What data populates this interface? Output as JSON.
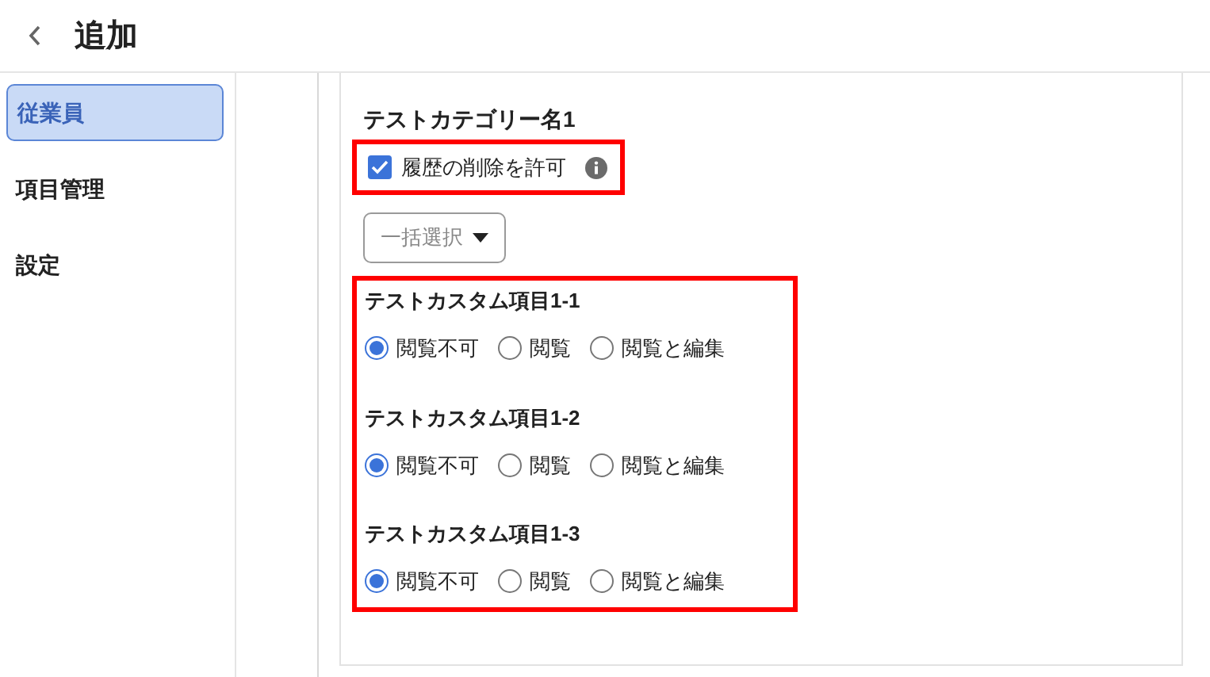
{
  "header": {
    "title": "追加"
  },
  "sidebar": {
    "items": [
      {
        "label": "従業員",
        "selected": true
      },
      {
        "label": "項目管理",
        "selected": false
      },
      {
        "label": "設定",
        "selected": false
      }
    ]
  },
  "category": {
    "title": "テストカテゴリー名1",
    "allow_delete_history": {
      "label": "履歴の削除を許可",
      "checked": true,
      "highlighted": true
    },
    "bulk_select": {
      "label": "一括選択"
    },
    "fields_highlighted": true,
    "fields": [
      {
        "name": "テストカスタム項目1-1",
        "options": [
          {
            "label": "閲覧不可",
            "selected": true
          },
          {
            "label": "閲覧",
            "selected": false
          },
          {
            "label": "閲覧と編集",
            "selected": false
          }
        ]
      },
      {
        "name": "テストカスタム項目1-2",
        "options": [
          {
            "label": "閲覧不可",
            "selected": true
          },
          {
            "label": "閲覧",
            "selected": false
          },
          {
            "label": "閲覧と編集",
            "selected": false
          }
        ]
      },
      {
        "name": "テストカスタム項目1-3",
        "options": [
          {
            "label": "閲覧不可",
            "selected": true
          },
          {
            "label": "閲覧",
            "selected": false
          },
          {
            "label": "閲覧と編集",
            "selected": false
          }
        ]
      }
    ]
  }
}
